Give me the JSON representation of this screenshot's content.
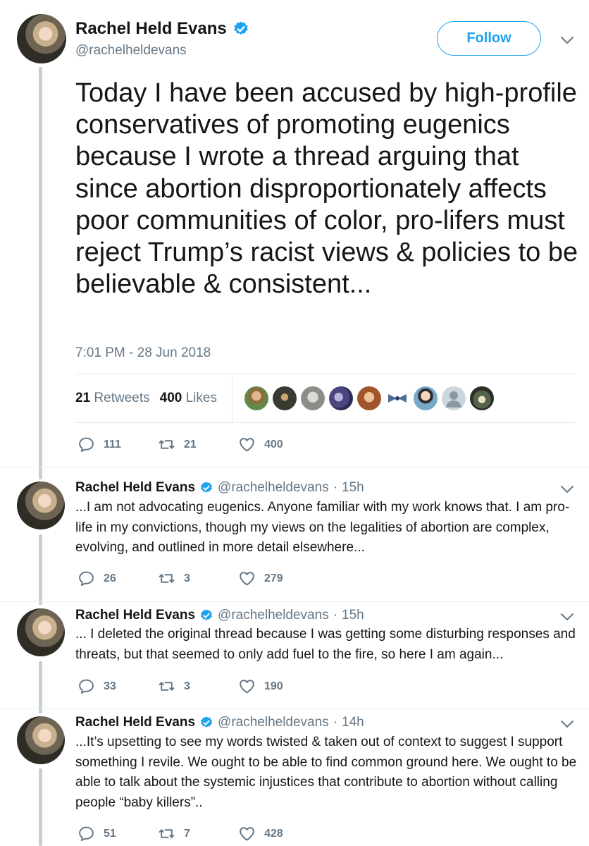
{
  "main_tweet": {
    "name": "Rachel Held Evans",
    "handle": "@rachelheldevans",
    "follow_label": "Follow",
    "text": "Today I have been accused by high-profile conservatives of promoting eugenics because I wrote a thread arguing that since abortion disproportionately affects poor communities of color, pro-lifers must reject Trump’s racist views & policies to be believable & consistent...",
    "timestamp": "7:01 PM - 28 Jun 2018",
    "retweets_count": "21",
    "retweets_label": "Retweets",
    "likes_count": "400",
    "likes_label": "Likes",
    "reply_count": "111",
    "retweet_action_count": "21",
    "like_action_count": "400"
  },
  "replies": [
    {
      "name": "Rachel Held Evans",
      "handle": "@rachelheldevans",
      "time": "15h",
      "text": "...I am not advocating eugenics. Anyone familiar with my work knows that. I am pro-life in my convictions, though my views on the legalities of abortion are complex, evolving, and outlined in more detail elsewhere...",
      "replies": "26",
      "retweets": "3",
      "likes": "279"
    },
    {
      "name": "Rachel Held Evans",
      "handle": "@rachelheldevans",
      "time": "15h",
      "text": "... I deleted the original thread because I was getting some disturbing responses and threats, but that seemed to only add fuel to the fire, so here I am again...",
      "replies": "33",
      "retweets": "3",
      "likes": "190"
    },
    {
      "name": "Rachel Held Evans",
      "handle": "@rachelheldevans",
      "time": "14h",
      "text": "...It’s upsetting to see my words twisted & taken out of context to suggest I support something I revile. We ought to be able to find common ground here. We ought to be able to talk about the systemic injustices that contribute to abortion without calling people “baby killers”..",
      "replies": "51",
      "retweets": "7",
      "likes": "428"
    }
  ],
  "colors": {
    "accent": "#1da1f2",
    "text": "#14171a",
    "muted": "#657786",
    "thread_line": "#c4cfd6"
  },
  "icons": {
    "verified": "verified-badge-icon",
    "caret": "chevron-down-icon",
    "reply": "reply-icon",
    "retweet": "retweet-icon",
    "like": "heart-icon"
  }
}
